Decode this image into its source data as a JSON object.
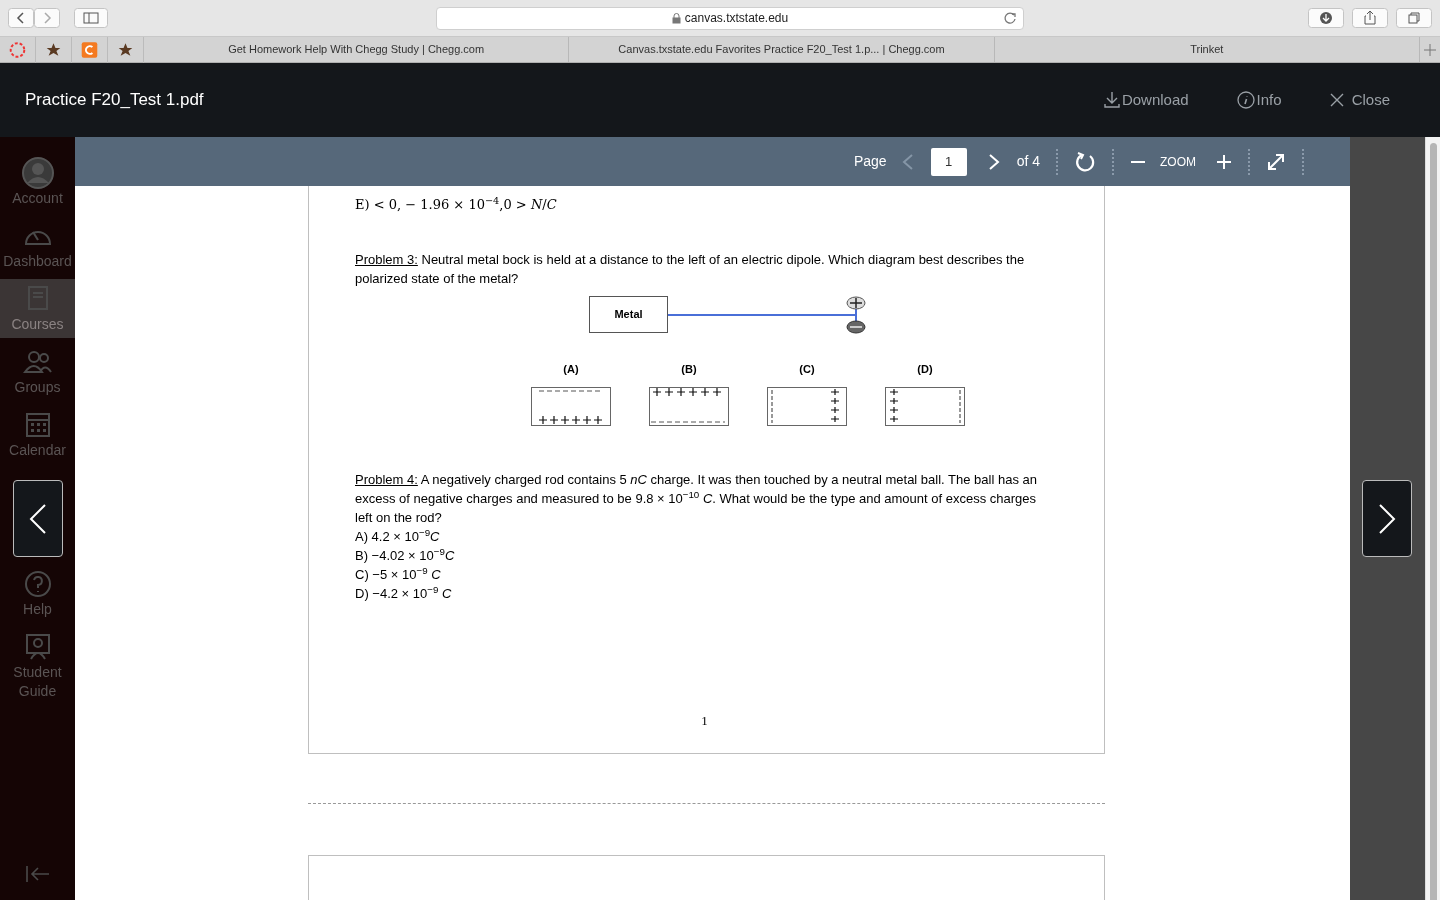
{
  "browser": {
    "address": "canvas.txtstate.edu",
    "tabs": [
      {
        "title": "Get Homework Help With Chegg Study | Chegg.com"
      },
      {
        "title": "Canvas.txstate.edu Favorites Practice F20_Test 1.p... | Chegg.com"
      },
      {
        "title": "Trinket"
      }
    ]
  },
  "viewer": {
    "title": "Practice F20_Test 1.pdf",
    "actions": [
      {
        "kind": "download",
        "label": "Download"
      },
      {
        "kind": "info",
        "label": "Info"
      },
      {
        "kind": "close",
        "label": "Close"
      }
    ],
    "toolbar": {
      "page_label": "Page",
      "page": "1",
      "of": "of 4",
      "prev_disabled": true,
      "zoom_label": "ZOOM"
    }
  },
  "sidebar": {
    "items": [
      {
        "kind": "account",
        "label": "Account",
        "selected": false
      },
      {
        "kind": "dashboard",
        "label": "Dashboard",
        "selected": false
      },
      {
        "kind": "courses",
        "label": "Courses",
        "selected": true
      },
      {
        "kind": "groups",
        "label": "Groups",
        "selected": false
      },
      {
        "kind": "calendar",
        "label": "Calendar",
        "selected": false
      },
      {
        "kind": "help",
        "label": "Help",
        "selected": false
      },
      {
        "kind": "guide",
        "label": "Student Guide",
        "selected": false
      }
    ]
  },
  "document": {
    "prev_answer": "E)  < 0, − 1.96 × 10$^{−4}$,0 > *N*/*C*",
    "problem3": {
      "label": "Problem 3:",
      "text": "Neutral metal bock is held at a distance to the left of an electric dipole. Which diagram best describes the polarized state of the metal?",
      "block_label": "Metal",
      "options": [
        {
          "label": "(A)",
          "kind": "neg-top"
        },
        {
          "label": "(B)",
          "kind": "pos-top"
        },
        {
          "label": "(C)",
          "kind": "pos-right"
        },
        {
          "label": "(D)",
          "kind": "pos-left"
        }
      ]
    },
    "problem4": {
      "label": "Problem 4:",
      "text": "A negatively charged rod contains 5 *nC* charge. It was then touched by a neutral metal ball. The ball has an excess of negative charges and measured to be 9.8 × 10$^{−10}$ *C*. What would be the type and amount of excess charges left on the rod?",
      "answers": [
        "A)  4.2 × 10$^{−9}$*C*",
        "B)  −4.02 × 10$^{−9}$*C*",
        "C)  −5 × 10$^{−9}$ *C*",
        "D)  −4.2 × 10$^{−9}$ *C*"
      ]
    },
    "page_number": "1"
  }
}
